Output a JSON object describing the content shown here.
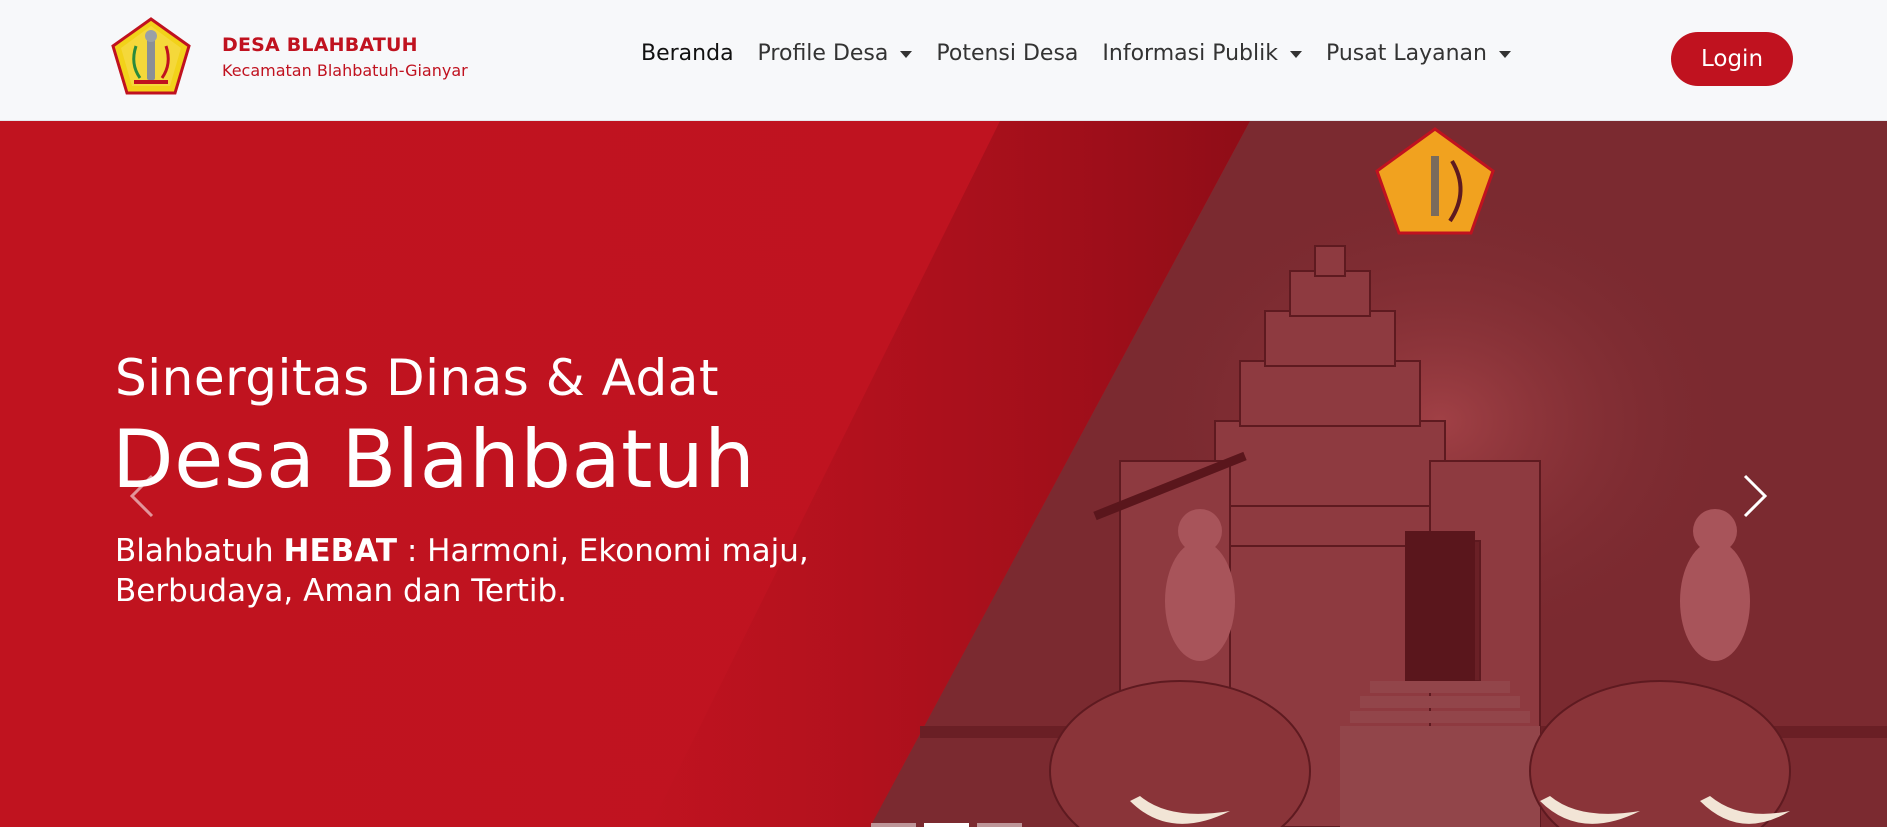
{
  "brand": {
    "title": "DESA BLAHBATUH",
    "subtitle": "Kecamatan Blahbatuh-Gianyar",
    "logo_icon": "village-emblem-icon"
  },
  "nav": {
    "items": [
      {
        "label": "Beranda",
        "dropdown": false,
        "active": true
      },
      {
        "label": "Profile Desa",
        "dropdown": true,
        "active": false
      },
      {
        "label": "Potensi Desa",
        "dropdown": false,
        "active": false
      },
      {
        "label": "Informasi Publik",
        "dropdown": true,
        "active": false
      },
      {
        "label": "Pusat Layanan",
        "dropdown": true,
        "active": false
      }
    ],
    "login_label": "Login"
  },
  "hero": {
    "kicker": "Sinergitas Dinas & Adat",
    "title": "Desa Blahbatuh",
    "tagline_prefix": "Blahbatuh ",
    "tagline_bold": "HEBAT",
    "tagline_rest": " : Harmoni, Ekonomi maju, Berbudaya, Aman dan Tertib.",
    "prev_icon": "chevron-left-icon",
    "next_icon": "chevron-right-icon",
    "slides_count": 3,
    "active_slide": 2
  },
  "colors": {
    "brand_red": "#c0121f",
    "navbar_bg": "#f7f8fa",
    "panel_red": "#7b2a30"
  }
}
